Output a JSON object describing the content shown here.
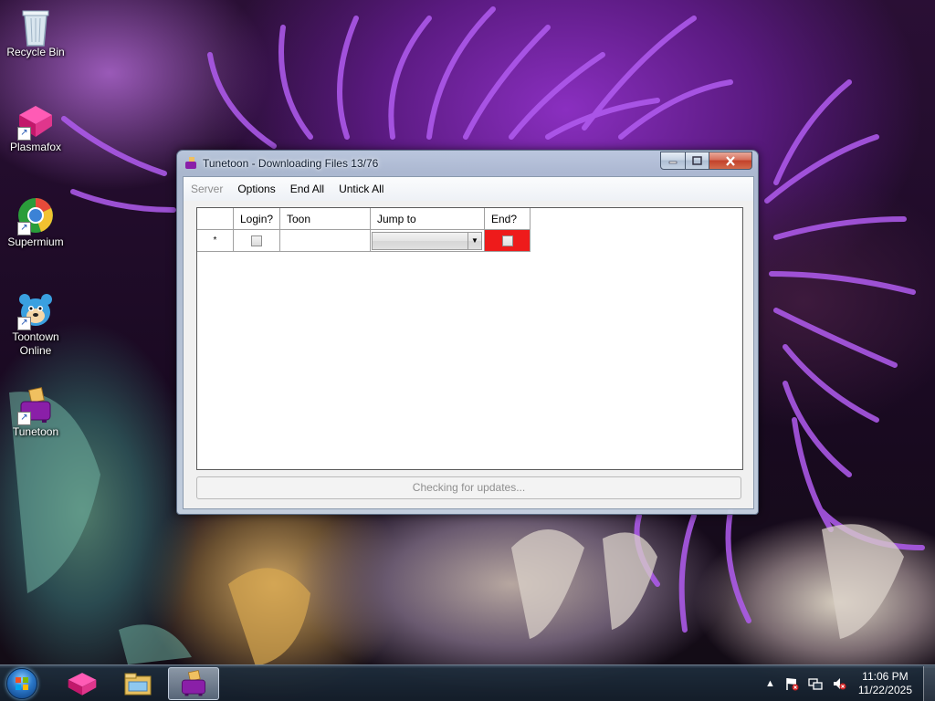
{
  "desktop": {
    "icons": [
      {
        "label": "Recycle Bin",
        "icon": "recycle-bin-icon"
      },
      {
        "label": "Plasmafox",
        "icon": "plasmafox-icon"
      },
      {
        "label": "Supermium",
        "icon": "supermium-icon"
      },
      {
        "label_line1": "Toontown",
        "label_line2": "Online",
        "icon": "toontown-icon"
      },
      {
        "label": "Tunetoon",
        "icon": "tunetoon-icon"
      }
    ]
  },
  "window": {
    "title": "Tunetoon - Downloading Files 13/76",
    "menu": [
      "Server",
      "Options",
      "End All",
      "Untick All"
    ],
    "menu_disabled": [
      "Server"
    ],
    "grid": {
      "columns": [
        "",
        "Login?",
        "Toon",
        "Jump to",
        "End?"
      ],
      "rows": [
        {
          "marker": "*",
          "login_checked": false,
          "toon": "",
          "jump_to": "",
          "end_checked": false
        }
      ]
    },
    "status": "Checking for updates...",
    "colors": {
      "end_cell": "#ee1b1b"
    }
  },
  "taskbar": {
    "pinned": [
      "start-orb",
      "plasmafox-icon",
      "file-explorer-icon",
      "tunetoon-icon"
    ],
    "active": "tunetoon-icon",
    "tray": {
      "expand": "▲",
      "time": "11:06 PM",
      "date": "11/22/2025"
    }
  }
}
